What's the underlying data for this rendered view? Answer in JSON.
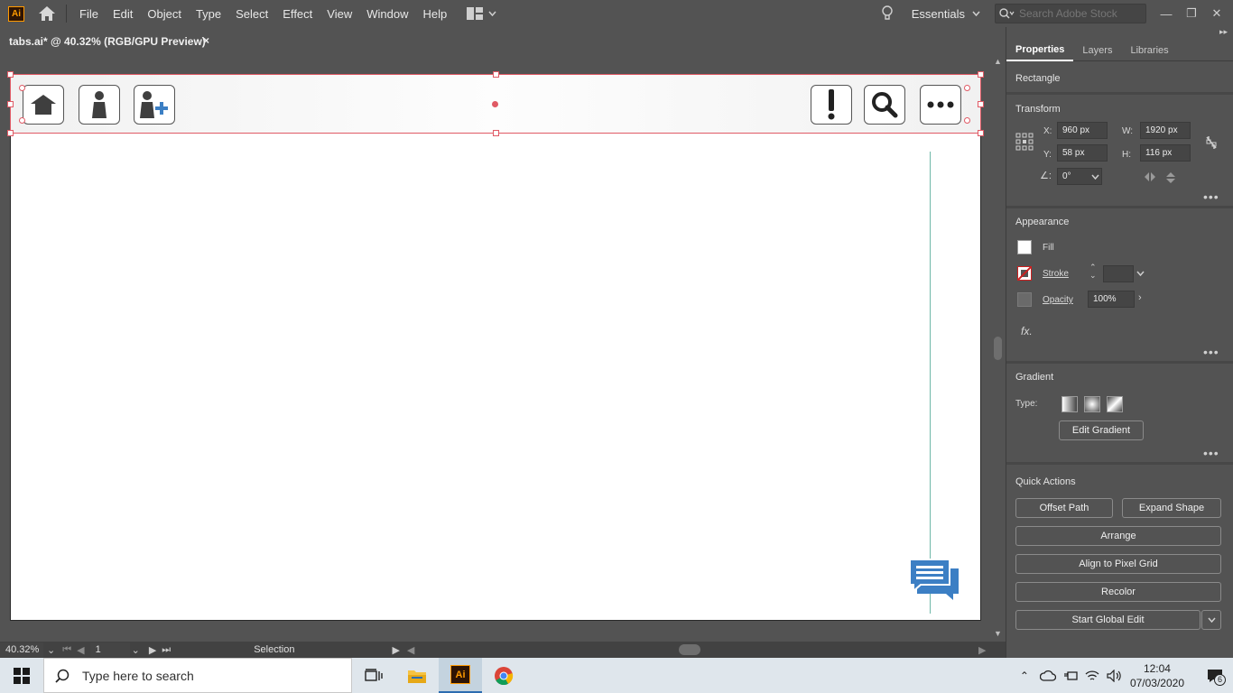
{
  "app": {
    "logo": "Ai",
    "home_icon": "home-icon"
  },
  "menu": [
    "File",
    "Edit",
    "Object",
    "Type",
    "Select",
    "Effect",
    "View",
    "Window",
    "Help"
  ],
  "workspace": {
    "label": "Essentials",
    "search_placeholder": "Search Adobe Stock"
  },
  "document": {
    "tab_title": "tabs.ai* @ 40.32% (RGB/GPU Preview)",
    "close": "×"
  },
  "canvas": {
    "toolbar_icons_left": [
      "home-icon",
      "person-icon",
      "add-person-icon"
    ],
    "toolbar_icons_right": [
      "exclamation-icon",
      "search-icon",
      "more-dots-icon"
    ],
    "colors": {
      "selection": "#e05a65",
      "guide": "#6fb8a8",
      "chat_icon": "#3c7fc4"
    }
  },
  "status": {
    "zoom": "40.32%",
    "artboard_num": "1",
    "tool": "Selection"
  },
  "panel": {
    "tabs": [
      "Properties",
      "Layers",
      "Libraries"
    ],
    "selection_type": "Rectangle",
    "transform": {
      "title": "Transform",
      "x_label": "X:",
      "x": "960 px",
      "y_label": "Y:",
      "y": "58 px",
      "w_label": "W:",
      "w": "1920 px",
      "h_label": "H:",
      "h": "116 px",
      "angle": "0°"
    },
    "appearance": {
      "title": "Appearance",
      "fill": "Fill",
      "stroke": "Stroke",
      "opacity": "Opacity",
      "opacity_value": "100%",
      "fx": "fx."
    },
    "gradient": {
      "title": "Gradient",
      "type_label": "Type:",
      "edit": "Edit Gradient"
    },
    "quick_actions": {
      "title": "Quick Actions",
      "offset": "Offset Path",
      "expand": "Expand Shape",
      "arrange": "Arrange",
      "align": "Align to Pixel Grid",
      "recolor": "Recolor",
      "global_edit": "Start Global Edit"
    }
  },
  "taskbar": {
    "search": "Type here to search",
    "time": "12:04",
    "date": "07/03/2020",
    "notifications": "6"
  }
}
